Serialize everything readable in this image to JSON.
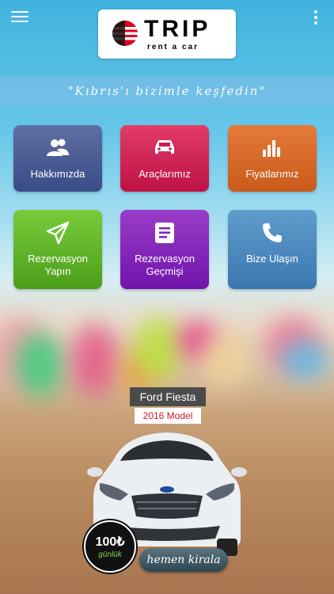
{
  "header": {
    "logo_title": "TRIP",
    "logo_subtitle": "rent a car",
    "menu_icon": "hamburger-menu-icon",
    "overflow_icon": "more-vertical-icon"
  },
  "slogan": "\"Kıbrıs'ı bizimle keşfedin\"",
  "tiles": [
    {
      "label": "Hakkımızda",
      "icon": "users-icon",
      "color": "#44558c"
    },
    {
      "label": "Araçlarımız",
      "icon": "car-icon",
      "color": "#cc1d50"
    },
    {
      "label": "Fiyatlarımız",
      "icon": "bar-chart-icon",
      "color": "#d66a28"
    },
    {
      "label": "Rezervasyon Yapın",
      "icon": "paper-plane-icon",
      "color": "#5fb528"
    },
    {
      "label": "Rezervasyon Geçmişi",
      "icon": "document-icon",
      "color": "#8021b8"
    },
    {
      "label": "Bize Ulaşın",
      "icon": "phone-icon",
      "color": "#4a88be"
    }
  ],
  "featured_car": {
    "name": "Ford Fiesta",
    "model": "2016 Model",
    "price": "100₺",
    "period": "günlük",
    "cta": "hemen kirala"
  }
}
